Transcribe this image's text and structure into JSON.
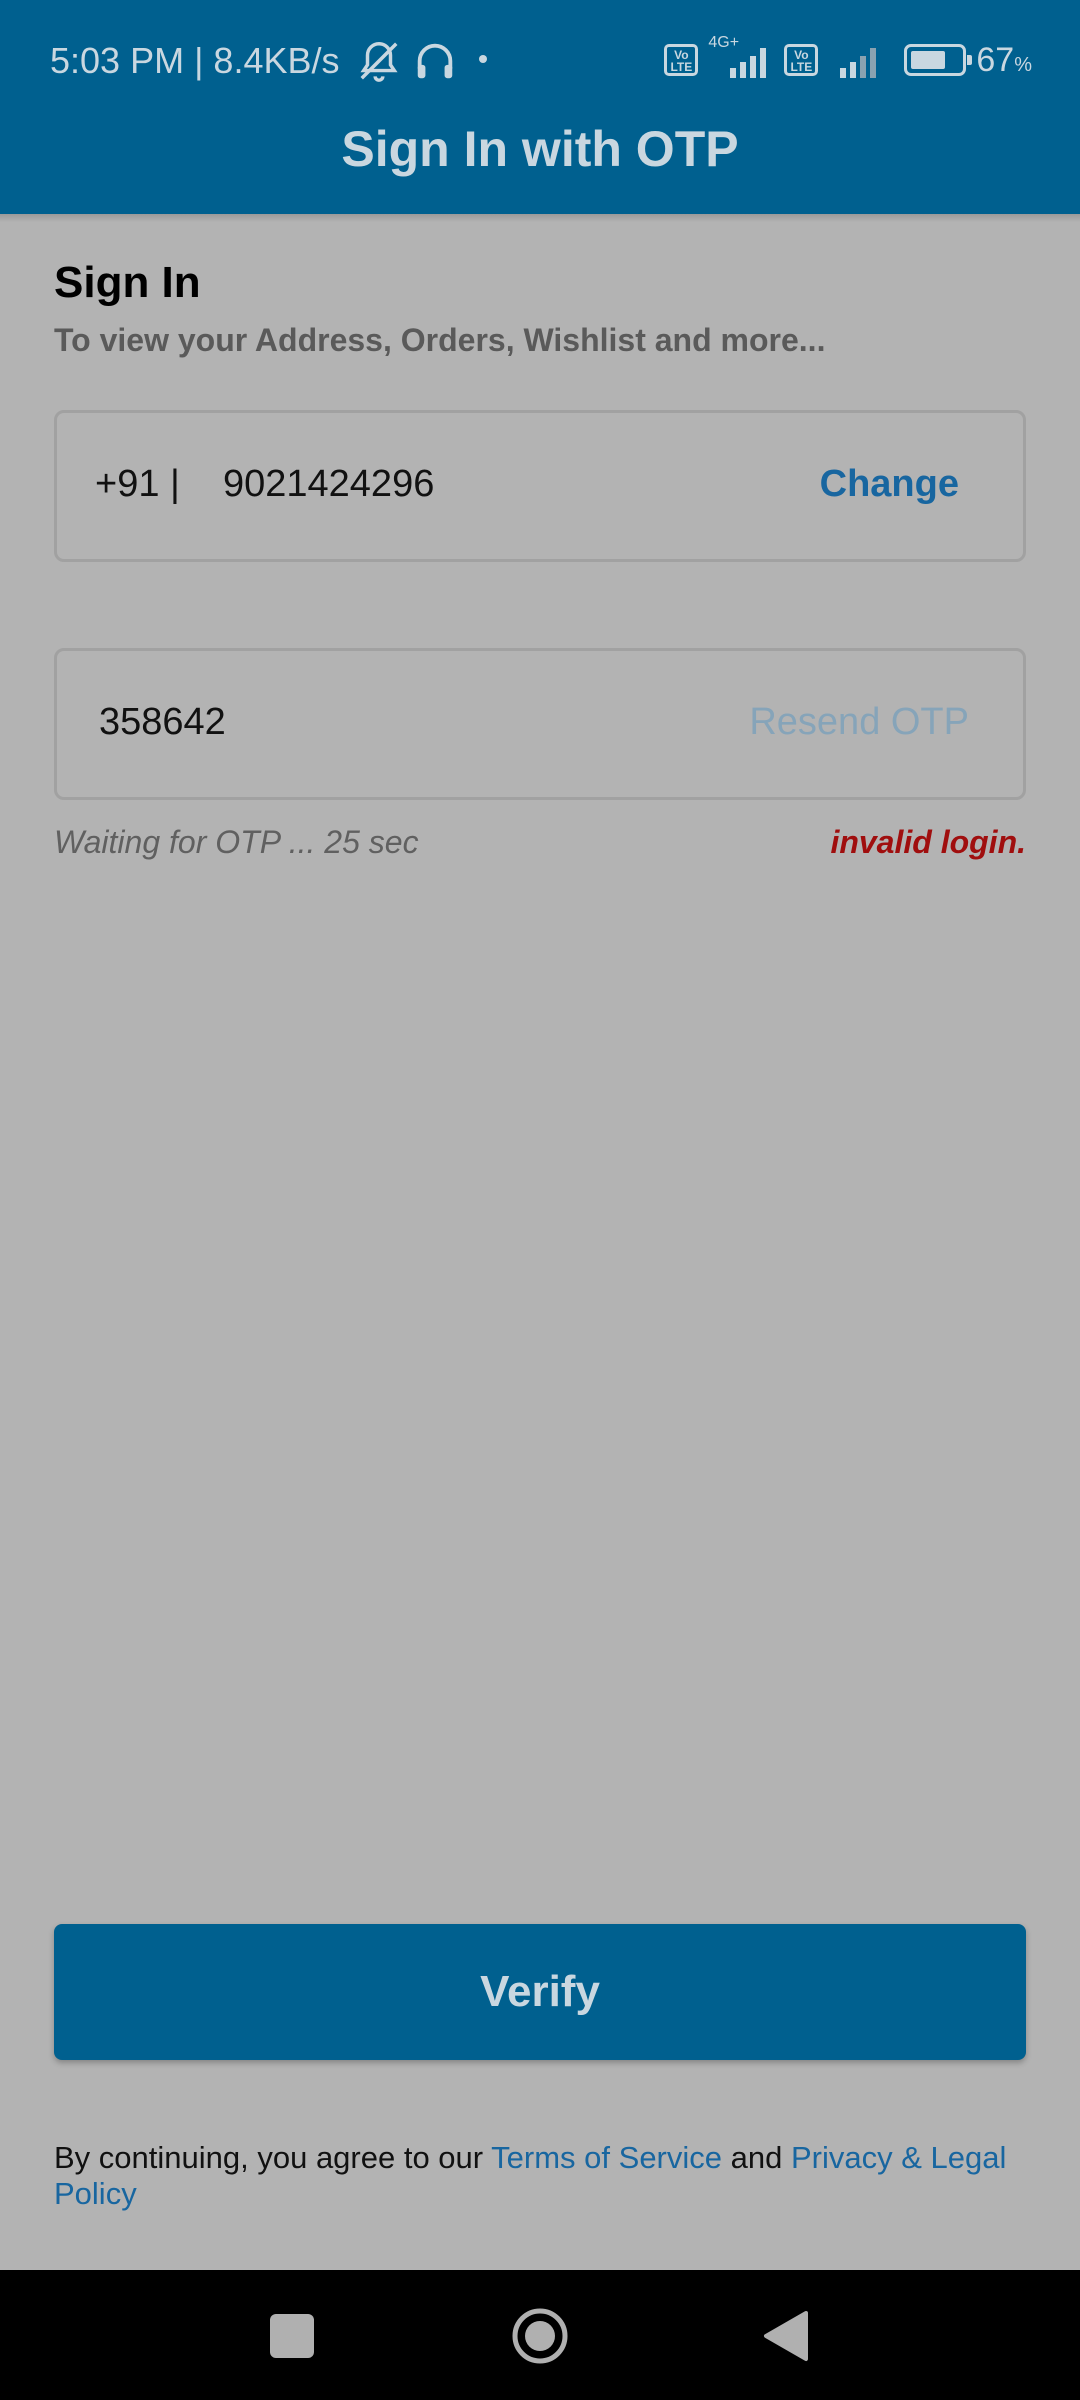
{
  "status_bar": {
    "time": "5:03 PM | 8.4KB/s",
    "network_label": "4G+",
    "volte_label": "Vo LTE",
    "battery_percent": "67",
    "battery_unit": "%",
    "battery_level": 0.67,
    "icons": [
      "muted-bell-icon",
      "headset-icon",
      "dot-icon",
      "volte-icon",
      "signal-icon",
      "battery-icon"
    ]
  },
  "header": {
    "title": "Sign In with OTP"
  },
  "signin": {
    "heading": "Sign In",
    "subheading": "To view your Address, Orders, Wishlist and more..."
  },
  "phone": {
    "country_code": "+91 |",
    "number": "9021424296",
    "change_label": "Change"
  },
  "otp": {
    "value": "358642",
    "resend_label": "Resend OTP",
    "waiting_text": "Waiting for OTP ...  25 sec",
    "error_text": "invalid login."
  },
  "actions": {
    "verify_label": "Verify"
  },
  "legal": {
    "prefix": "By continuing, you agree to our ",
    "terms_label": "Terms of Service",
    "and": " and ",
    "privacy_label": "Privacy & Legal Policy"
  },
  "colors": {
    "app_bar": "#00608f",
    "link": "#1866a0",
    "error": "#a00e0e",
    "overlay_bg": "#b3b3b3"
  }
}
